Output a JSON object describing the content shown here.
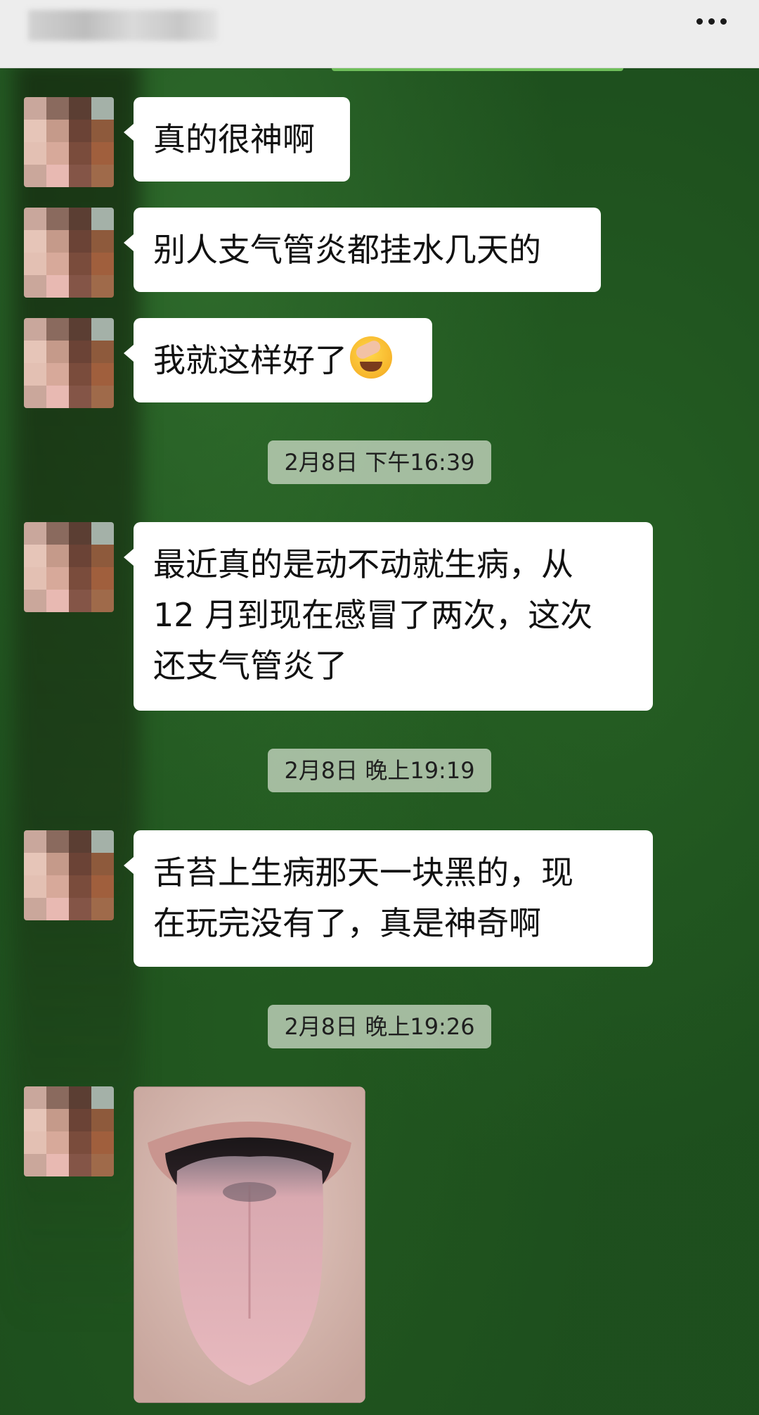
{
  "header": {
    "more_icon": "more-dots-icon"
  },
  "messages": [
    {
      "type": "text",
      "text": "真的很神啊"
    },
    {
      "type": "text",
      "text": "别人支气管炎都挂水几天的"
    },
    {
      "type": "text",
      "text": "我就这样好了",
      "emoji": "facepalm-laugh-emoji"
    },
    {
      "type": "timestamp",
      "text": "2月8日 下午16:39"
    },
    {
      "type": "text",
      "lines": [
        "最近真的是动不动就生病，从",
        "12 月到现在感冒了两次，这次",
        "还支气管炎了"
      ]
    },
    {
      "type": "timestamp",
      "text": "2月8日 晚上19:19"
    },
    {
      "type": "text",
      "lines": [
        "舌苔上生病那天一块黑的，现",
        "在玩完没有了，真是神奇啊"
      ]
    },
    {
      "type": "timestamp",
      "text": "2月8日 晚上19:26"
    },
    {
      "type": "image",
      "content": "photo of open mouth showing tongue"
    }
  ],
  "colors": {
    "bubble": "#ffffff",
    "chat_background": "#1d4e1d",
    "timestamp_bg": "#c8d7c3",
    "header_bg": "#ededed"
  }
}
